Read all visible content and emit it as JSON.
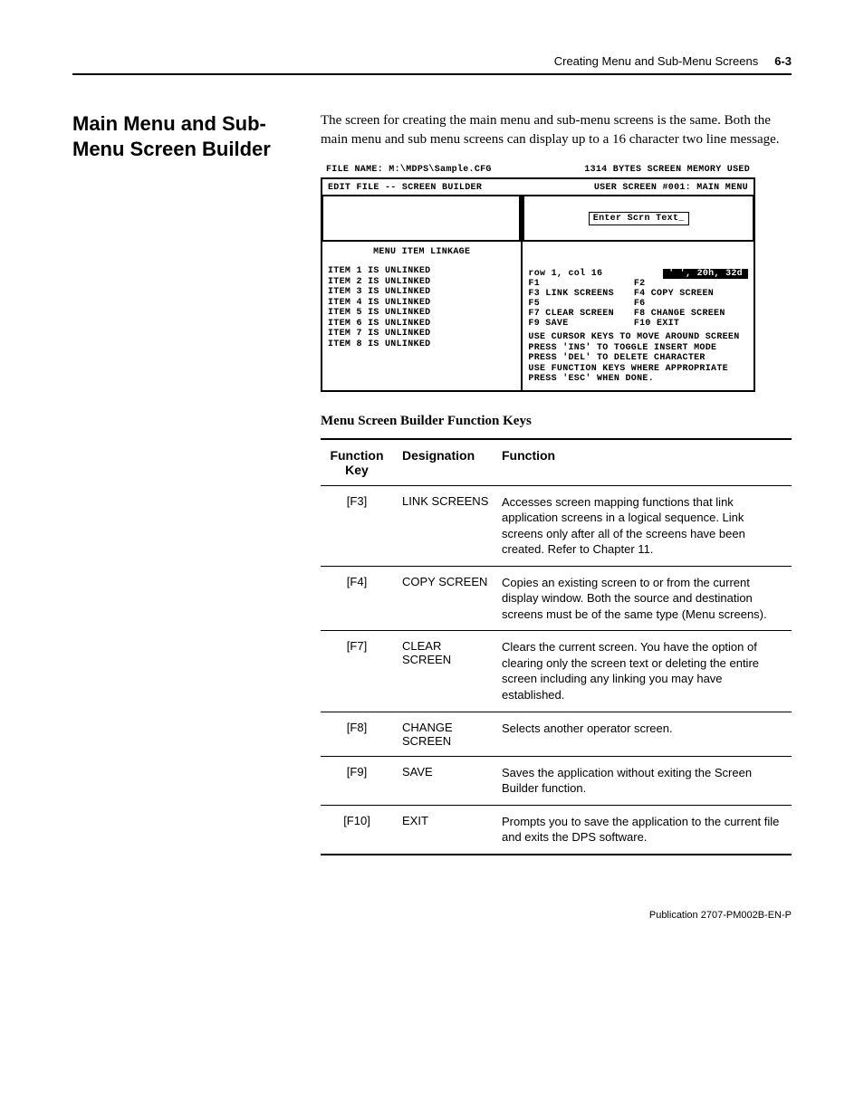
{
  "header": {
    "chapter_title": "Creating Menu and Sub-Menu Screens",
    "page_number": "6-3"
  },
  "section": {
    "title": "Main Menu and Sub-Menu Screen Builder",
    "paragraph": "The screen for creating the main menu and sub-menu screens is the same. Both the main menu and sub menu screens can display up to a 16 character two line message."
  },
  "terminal": {
    "file_name": "FILE NAME: M:\\MDPS\\Sample.CFG",
    "bytes_used": "1314 BYTES SCREEN MEMORY USED",
    "title_left": "EDIT FILE -- SCREEN BUILDER",
    "title_right": "USER SCREEN #001: MAIN MENU",
    "enter_text": "Enter Scrn Text_",
    "linkage_title": "MENU ITEM LINKAGE",
    "linkage_items": [
      "ITEM 1 IS UNLINKED",
      "ITEM 2 IS UNLINKED",
      "ITEM 3 IS UNLINKED",
      "ITEM 4 IS UNLINKED",
      "ITEM 5 IS UNLINKED",
      "ITEM 6 IS UNLINKED",
      "ITEM 7 IS UNLINKED",
      "ITEM 8 IS UNLINKED"
    ],
    "status_rowcol": "row  1, col 16",
    "status_hex": "' ', 20h,  32d",
    "fkeys": [
      {
        "l": "F1",
        "r": "F2"
      },
      {
        "l": "F3 LINK SCREENS",
        "r": "F4  COPY SCREEN"
      },
      {
        "l": "F5",
        "r": "F6"
      },
      {
        "l": "F7 CLEAR SCREEN",
        "r": "F8  CHANGE SCREEN"
      },
      {
        "l": "F9 SAVE",
        "r": "F10 EXIT"
      }
    ],
    "hints": [
      "USE CURSOR KEYS TO MOVE AROUND SCREEN",
      "PRESS 'INS' TO TOGGLE INSERT MODE",
      "PRESS 'DEL' TO DELETE CHARACTER",
      "USE FUNCTION KEYS WHERE APPROPRIATE",
      "PRESS 'ESC' WHEN DONE."
    ]
  },
  "table": {
    "heading": "Menu Screen Builder Function Keys",
    "columns": [
      "Function Key",
      "Designation",
      "Function"
    ],
    "rows": [
      {
        "key": "[F3]",
        "desig": "LINK SCREENS",
        "func": "Accesses screen mapping functions that link application screens in a logical sequence. Link screens only after all of the screens have been created.  Refer to Chapter 11."
      },
      {
        "key": "[F4]",
        "desig": "COPY SCREEN",
        "func": "Copies an existing screen to or from the current display window.  Both the source and destination screens must be of the same type (Menu screens)."
      },
      {
        "key": "[F7]",
        "desig": "CLEAR SCREEN",
        "func": "Clears the current screen.  You have the option of clearing only the screen text or deleting the entire screen including any linking you may have established."
      },
      {
        "key": "[F8]",
        "desig": "CHANGE SCREEN",
        "func": "Selects another operator screen."
      },
      {
        "key": "[F9]",
        "desig": "SAVE",
        "func": "Saves the application without exiting the Screen Builder function."
      },
      {
        "key": "[F10]",
        "desig": "EXIT",
        "func": "Prompts you to save the application to the current file and exits the DPS software."
      }
    ]
  },
  "footer": {
    "publication": "Publication 2707-PM002B-EN-P"
  }
}
